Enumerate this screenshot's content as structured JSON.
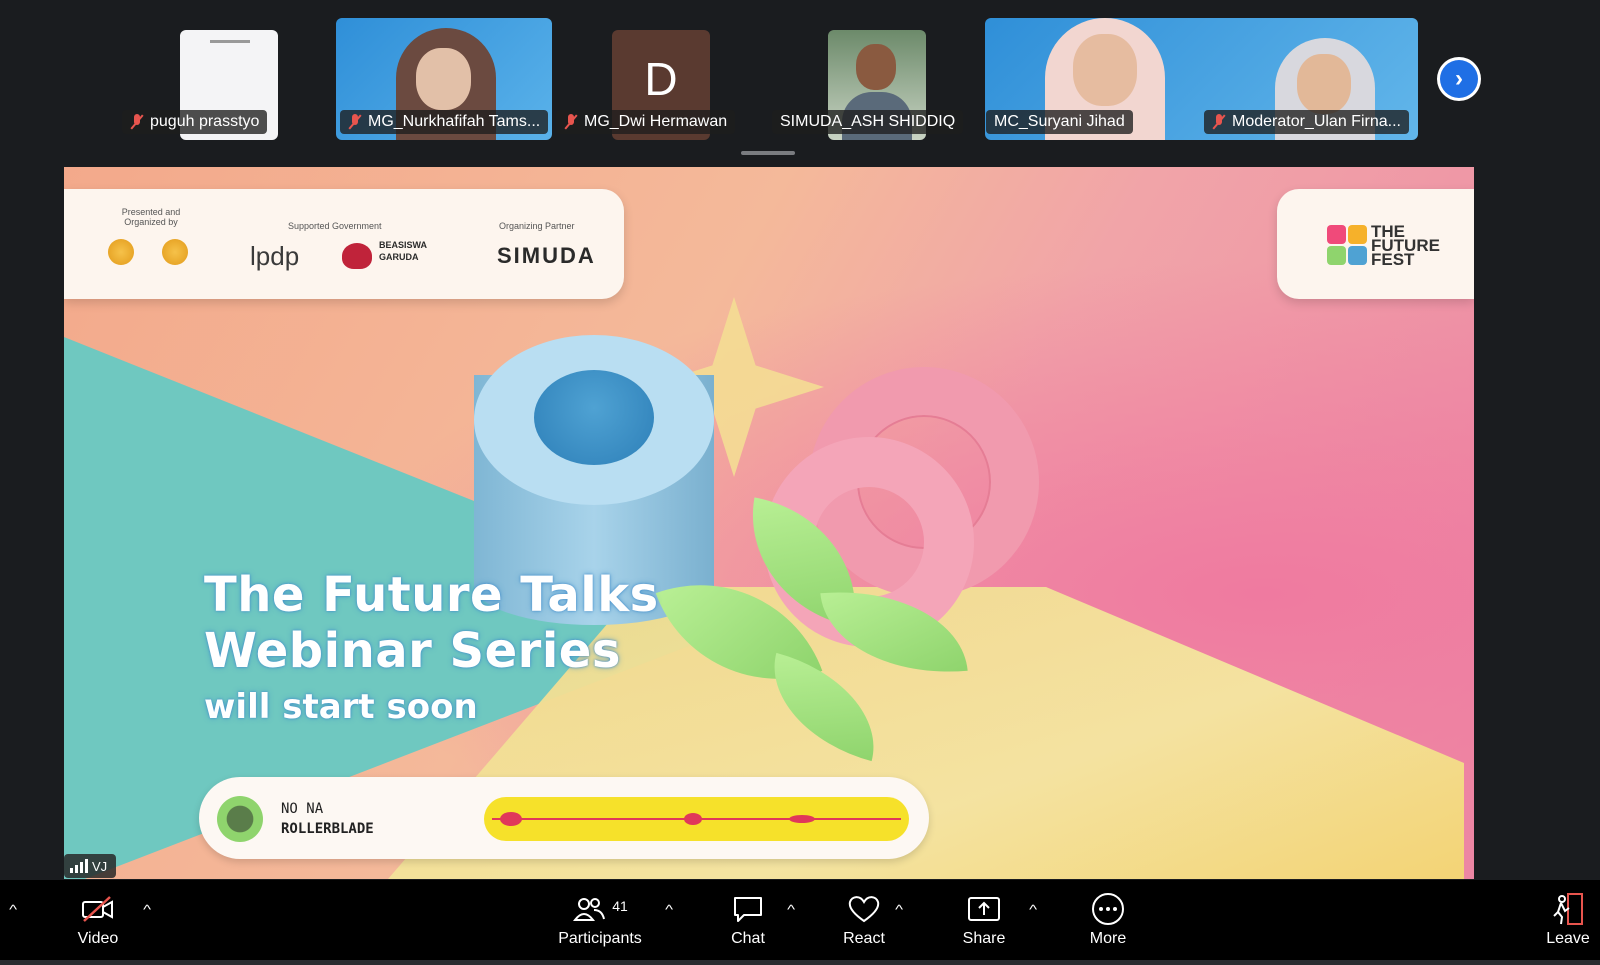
{
  "gallery": {
    "participants": [
      {
        "name": "puguh prasstyo",
        "muted": true
      },
      {
        "name": "MG_Nurkhafifah Tams...",
        "muted": true
      },
      {
        "name": "MG_Dwi Hermawan",
        "muted": true,
        "avatar_letter": "D"
      },
      {
        "name": "SIMUDA_ASH SHIDDIQ",
        "muted": false
      },
      {
        "name": "MC_Suryani Jihad",
        "muted": false
      },
      {
        "name": "Moderator_Ulan Firna...",
        "muted": true
      }
    ],
    "next_icon": "chevron-right-icon"
  },
  "shared_screen": {
    "presented_by": "Presented and Organized by",
    "supported_by": "Supported Government",
    "organizing_partner": "Organizing Partner",
    "lpdp": "lpdp",
    "beasiswa": "BEASISWA GARUDA",
    "simuda": "SIMUDA",
    "future_fest": "THE FUTURE FEST",
    "headline_line1": "The Future Talks",
    "headline_line2": "Webinar Series",
    "headline_line3": "will start soon",
    "track_artist": "NO NA",
    "track_title": "ROLLERBLADE"
  },
  "signal_label": "VJ",
  "toolbar": {
    "video_label": "Video",
    "participants_label": "Participants",
    "participants_count": "41",
    "chat_label": "Chat",
    "react_label": "React",
    "share_label": "Share",
    "more_label": "More",
    "leave_label": "Leave"
  },
  "colors": {
    "accent": "#1f6fe5",
    "muted_red": "#e8554e",
    "toolbar_bg": "#000000",
    "app_bg": "#1a1c1f"
  }
}
